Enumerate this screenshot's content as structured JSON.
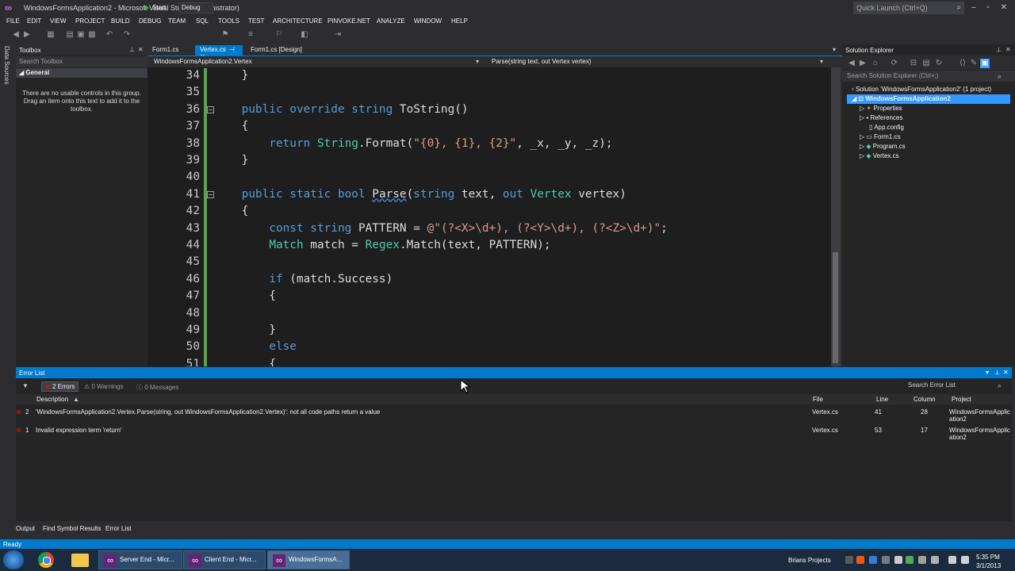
{
  "window": {
    "title": "WindowsFormsApplication2 - Microsoft Visual Studio (Administrator)",
    "quick_launch_placeholder": "Quick Launch (Ctrl+Q)"
  },
  "menu": [
    "FILE",
    "EDIT",
    "VIEW",
    "PROJECT",
    "BUILD",
    "DEBUG",
    "TEAM",
    "SQL",
    "TOOLS",
    "TEST",
    "ARCHITECTURE",
    "PINVOKE.NET",
    "ANALYZE",
    "WINDOW",
    "HELP"
  ],
  "toolbar": {
    "start_label": "Start",
    "config_value": "Debug"
  },
  "left_strip": {
    "data_sources": "Data Sources"
  },
  "toolbox": {
    "title": "Toolbox",
    "search_placeholder": "Search Toolbox",
    "group": "General",
    "empty_text": "There are no usable controls in this group. Drag an item onto this text to add it to the toolbox."
  },
  "editor": {
    "tabs": [
      "Form1.cs",
      "Vertex.cs",
      "Form1.cs [Design]"
    ],
    "nav_left": "WindowsFormsApplication2.Vertex",
    "nav_right": "Parse(string text, out Vertex vertex)",
    "lines": [
      {
        "n": "34",
        "code": "    }"
      },
      {
        "n": "35",
        "code": ""
      },
      {
        "n": "36",
        "code": "    public override string ToString()"
      },
      {
        "n": "37",
        "code": "    {"
      },
      {
        "n": "38",
        "code": "        return String.Format(\"{0}, {1}, {2}\", _x, _y, _z);"
      },
      {
        "n": "39",
        "code": "    }"
      },
      {
        "n": "40",
        "code": ""
      },
      {
        "n": "41",
        "code": "    public static bool Parse(string text, out Vertex vertex)"
      },
      {
        "n": "42",
        "code": "    {"
      },
      {
        "n": "43",
        "code": "        const string PATTERN = @\"(?<X>\\d+), (?<Y>\\d+), (?<Z>\\d+)\";"
      },
      {
        "n": "44",
        "code": "        Match match = Regex.Match(text, PATTERN);"
      },
      {
        "n": "45",
        "code": ""
      },
      {
        "n": "46",
        "code": "        if (match.Success)"
      },
      {
        "n": "47",
        "code": "        {"
      },
      {
        "n": "48",
        "code": ""
      },
      {
        "n": "49",
        "code": "        }"
      },
      {
        "n": "50",
        "code": "        else"
      },
      {
        "n": "51",
        "code": "        {"
      }
    ]
  },
  "solution_explorer": {
    "title": "Solution Explorer",
    "search_placeholder": "Search Solution Explorer (Ctrl+;)",
    "items": [
      {
        "label": "Solution 'WindowsFormsApplication2' (1 project)"
      },
      {
        "label": "WindowsFormsApplication2"
      },
      {
        "label": "Properties"
      },
      {
        "label": "References"
      },
      {
        "label": "App.config"
      },
      {
        "label": "Form1.cs"
      },
      {
        "label": "Program.cs"
      },
      {
        "label": "Vertex.cs"
      }
    ]
  },
  "error_list": {
    "title": "Error List",
    "filters": {
      "errors": "2 Errors",
      "warnings": "0 Warnings",
      "messages": "0 Messages"
    },
    "search_placeholder": "Search Error List",
    "columns": {
      "description": "Description",
      "file": "File",
      "line": "Line",
      "column": "Column",
      "project": "Project"
    },
    "rows": [
      {
        "num": "2",
        "description": "'WindowsFormsApplication2.Vertex.Parse(string, out WindowsFormsApplication2.Vertex)': not all code paths return a value",
        "file": "Vertex.cs",
        "line": "41",
        "column": "28",
        "project_1": "WindowsFormsApplic",
        "project_2": "ation2"
      },
      {
        "num": "1",
        "description": "Invalid expression term 'return'",
        "file": "Vertex.cs",
        "line": "53",
        "column": "17",
        "project_1": "WindowsFormsApplic",
        "project_2": "ation2"
      }
    ]
  },
  "bottom_tabs": [
    "Output",
    "Find Symbol Results",
    "Error List"
  ],
  "status": {
    "text": "Ready"
  },
  "taskbar": {
    "tasks": [
      "Server End - Micr...",
      "Client End - Micr...",
      "WindowsFormsA..."
    ],
    "tray_label": "Brians Projects",
    "time": "5:35 PM",
    "date": "3/1/2013"
  },
  "colors": {
    "accent": "#007acc",
    "keyword": "#569cd6",
    "type": "#4ec9b0",
    "string": "#d69d85",
    "error": "#e51400"
  }
}
